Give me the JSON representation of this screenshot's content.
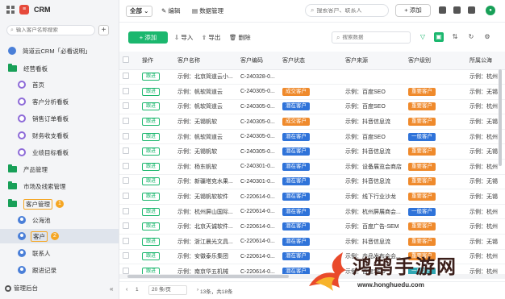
{
  "app": {
    "name": "CRM"
  },
  "sidebar": {
    "search_placeholder": "输入客户名称搜索",
    "items": [
      {
        "label": "简道云CRM「必看说明」"
      },
      {
        "label": "经营看板"
      },
      {
        "label": "首页"
      },
      {
        "label": "客户分析看板"
      },
      {
        "label": "销售订单看板"
      },
      {
        "label": "财务收支看板"
      },
      {
        "label": "业绩目标看板"
      },
      {
        "label": "产品管理"
      },
      {
        "label": "市场及线索管理"
      },
      {
        "label": "客户管理",
        "badge": "1"
      },
      {
        "label": "公海池"
      },
      {
        "label": "客户",
        "badge": "2"
      },
      {
        "label": "联系人"
      },
      {
        "label": "跟进记录"
      }
    ],
    "admin_label": "管理后台",
    "collapse_icon": "«"
  },
  "topbar": {
    "all_label": "全部",
    "edit_label": "编辑",
    "data_label": "数据管理",
    "search_placeholder": "搜索客户、联系人",
    "add_label": "+ 添加"
  },
  "toolbar": {
    "new_label": "+ 添加",
    "import_label": "导入",
    "export_label": "导出",
    "delete_label": "删除",
    "search_placeholder": "搜索数据"
  },
  "table": {
    "columns": [
      "操作",
      "客户名称",
      "客户编码",
      "客户状态",
      "客户来源",
      "客户级别",
      "所属公海"
    ],
    "follow_label": "跟进",
    "rows": [
      {
        "name": "示例：北京简道云小...",
        "code": "C-240328-0...",
        "status": "",
        "source": "",
        "level": "",
        "sea": "示例：杭州"
      },
      {
        "name": "示例：帆软简道云",
        "code": "C-240305-0...",
        "status": "成交客户",
        "status_color": "orange",
        "source": "示例：百度SEO",
        "level": "重要客户",
        "level_color": "orange",
        "sea": "示例：无锡"
      },
      {
        "name": "示例：帆软简道云",
        "code": "C-240305-0...",
        "status": "潜在客户",
        "status_color": "blue",
        "source": "示例：百度SEO",
        "level": "重要客户",
        "level_color": "orange",
        "sea": "示例：杭州"
      },
      {
        "name": "示例：无锡帆软",
        "code": "C-240305-0...",
        "status": "成交客户",
        "status_color": "orange",
        "source": "示例：抖音信息流",
        "level": "重要客户",
        "level_color": "orange",
        "sea": "示例：无锡"
      },
      {
        "name": "示例：帆软简道云",
        "code": "C-240305-0...",
        "status": "潜在客户",
        "status_color": "blue",
        "source": "示例：百度SEO",
        "level": "一般客户",
        "level_color": "blue",
        "sea": "示例：杭州"
      },
      {
        "name": "示例：无锡帆软",
        "code": "C-240305-0...",
        "status": "潜在客户",
        "status_color": "blue",
        "source": "示例：抖音信息流",
        "level": "重要客户",
        "level_color": "orange",
        "sea": "示例：无锡"
      },
      {
        "name": "示例：杨东帆软",
        "code": "C-240301-0...",
        "status": "潜在客户",
        "status_color": "blue",
        "source": "示例：设备展览会商店",
        "level": "重要客户",
        "level_color": "orange",
        "sea": "示例：杭州"
      },
      {
        "name": "示例：新疆塔克水果...",
        "code": "C-240301-0...",
        "status": "潜在客户",
        "status_color": "blue",
        "source": "示例：抖音信息流",
        "level": "重要客户",
        "level_color": "orange",
        "sea": "示例：无锡"
      },
      {
        "name": "示例：无锡帆软软件",
        "code": "C-220614-0...",
        "status": "潜在客户",
        "status_color": "blue",
        "source": "示例：线下行业沙龙",
        "level": "重要客户",
        "level_color": "orange",
        "sea": "示例：无锡"
      },
      {
        "name": "示例：杭州屏山国际...",
        "code": "C-220614-0...",
        "status": "潜在客户",
        "status_color": "blue",
        "source": "示例：杭州屏展商会...",
        "level": "一般客户",
        "level_color": "blue",
        "sea": "示例：杭州"
      },
      {
        "name": "示例：北京天诚软件...",
        "code": "C-220614-0...",
        "status": "潜在客户",
        "status_color": "blue",
        "source": "示例：百度广告-SEM",
        "level": "重要客户",
        "level_color": "orange",
        "sea": "示例：杭州"
      },
      {
        "name": "示例：浙江晨光文具...",
        "code": "C-220614-0...",
        "status": "潜在客户",
        "status_color": "blue",
        "source": "示例：抖音信息流",
        "level": "重要客户",
        "level_color": "orange",
        "sea": "示例：无锡"
      },
      {
        "name": "示例：安徽泰乐集团",
        "code": "C-220614-0...",
        "status": "潜在客户",
        "status_color": "blue",
        "source": "示例：产品发布会会...",
        "level": "重要客户",
        "level_color": "orange",
        "sea": "示例：杭州"
      },
      {
        "name": "示例：南京华五机械",
        "code": "C-220614-0...",
        "status": "潜在客户",
        "status_color": "blue",
        "source": "示例：百度SEO",
        "level": "一般客户",
        "level_color": "teal",
        "sea": "示例：杭州"
      }
    ]
  },
  "footer": {
    "page_size": "20 条/页",
    "page": "1",
    "summary": "13条，共18条"
  },
  "watermark": {
    "text": "鸿鹄手游网",
    "url": "www.honghuedu.com"
  },
  "colors": {
    "green": "#1bb76e",
    "blue": "#2f73d9",
    "orange": "#ef8a2c",
    "teal": "#2fa7b3",
    "badge": "#f5a623"
  }
}
